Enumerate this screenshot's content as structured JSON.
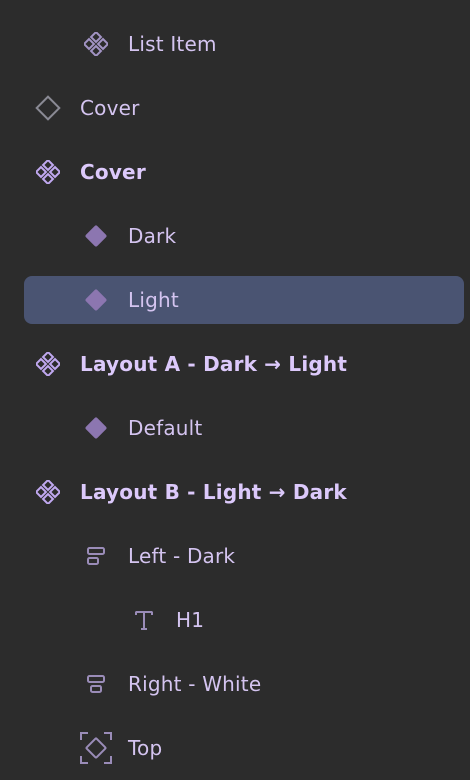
{
  "colors": {
    "background": "#2c2c2c",
    "selection": "#4a5472",
    "component_accent": "#c0a8f0",
    "instance_fill": "#8c76b0",
    "frame_stroke": "#9a8cb8",
    "text": "#d9c8f5"
  },
  "layers": [
    {
      "label": "List Item",
      "icon": "component-icon-muted"
    },
    {
      "label": "Cover",
      "icon": "diamond-outline-icon"
    },
    {
      "label": "Cover",
      "icon": "component-icon"
    },
    {
      "label": "Dark",
      "icon": "instance-diamond-icon"
    },
    {
      "label": "Light",
      "icon": "instance-diamond-icon"
    },
    {
      "label": "Layout A - Dark → Light",
      "icon": "component-icon"
    },
    {
      "label": "Default",
      "icon": "instance-diamond-icon"
    },
    {
      "label": "Layout B - Light → Dark",
      "icon": "component-icon"
    },
    {
      "label": "Left - Dark",
      "icon": "auto-layout-left-icon"
    },
    {
      "label": "H1",
      "icon": "text-icon"
    },
    {
      "label": "Right - White",
      "icon": "auto-layout-center-icon"
    },
    {
      "label": "Top",
      "icon": "component-frame-icon"
    }
  ]
}
